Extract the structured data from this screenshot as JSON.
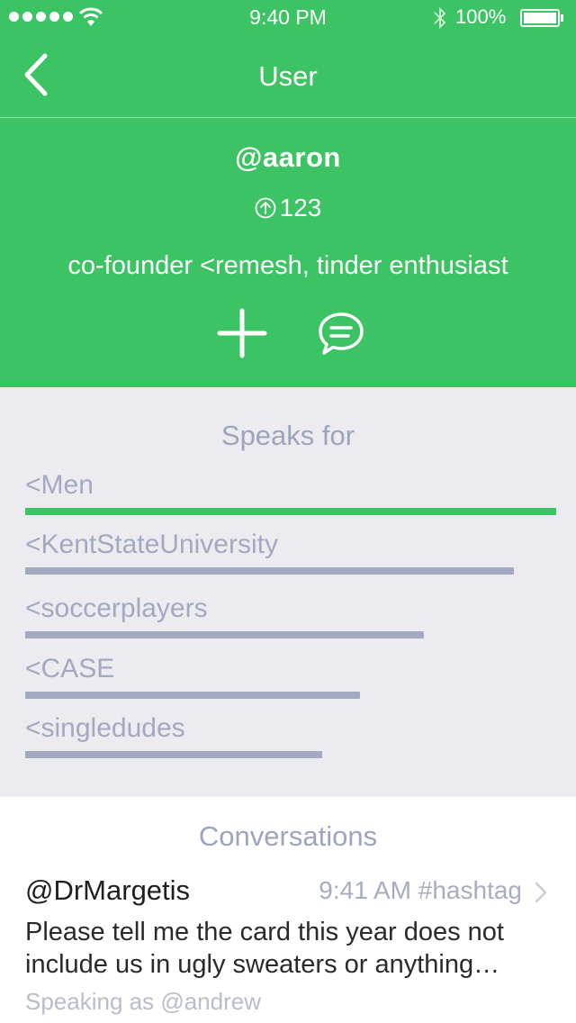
{
  "status_bar": {
    "time": "9:40 PM",
    "battery": "100%"
  },
  "nav": {
    "title": "User"
  },
  "profile": {
    "handle": "@aaron",
    "score": "123",
    "bio": "co-founder <remesh, tinder enthusiast"
  },
  "speaks_for": {
    "heading": "Speaks for",
    "groups": [
      {
        "label": "<Men",
        "fraction": 1.0,
        "color": "#3cc363"
      },
      {
        "label": "<KentStateUniversity",
        "fraction": 0.92,
        "color": "#a3a9c0"
      },
      {
        "label": "<soccerplayers",
        "fraction": 0.75,
        "color": "#a3a9c0"
      },
      {
        "label": "<CASE",
        "fraction": 0.63,
        "color": "#a3a9c0"
      },
      {
        "label": "<singledudes",
        "fraction": 0.56,
        "color": "#a3a9c0"
      }
    ]
  },
  "conversations": {
    "heading": "Conversations",
    "items": [
      {
        "user": "@DrMargetis",
        "meta": "9:41 AM #hashtag",
        "message": "Please tell me the card this year does not include us in ugly sweaters or anything…",
        "speaking_as": "Speaking as @andrew"
      }
    ]
  },
  "colors": {
    "accent": "#3cc363",
    "muted": "#a3a9c0",
    "panel": "#ebebf0"
  }
}
